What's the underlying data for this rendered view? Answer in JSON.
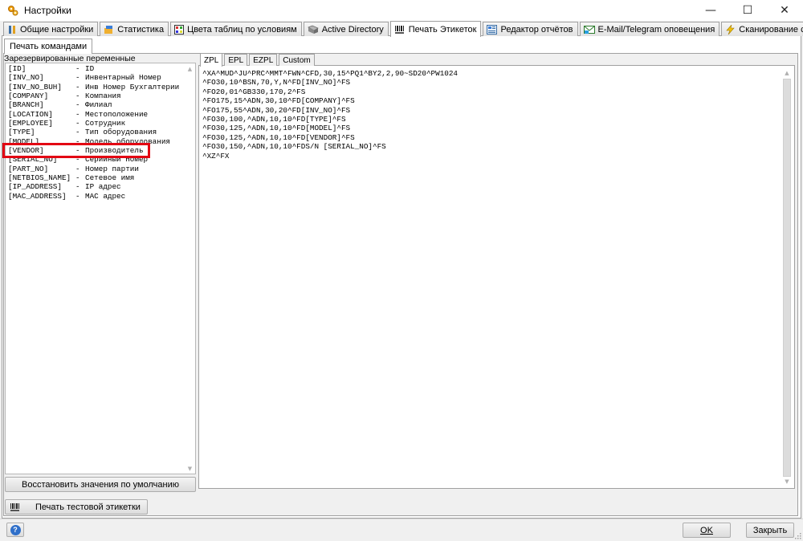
{
  "window": {
    "title": "Настройки",
    "controls": {
      "minimize": "—",
      "maximize": "☐",
      "close": "✕"
    }
  },
  "main_tabs": [
    {
      "label": "Общие настройки",
      "icon": "settings-wrench-icon"
    },
    {
      "label": "Статистика",
      "icon": "statistics-icon"
    },
    {
      "label": "Цвета таблиц по условиям",
      "icon": "color-grid-icon"
    },
    {
      "label": "Active Directory",
      "icon": "directory-icon"
    },
    {
      "label": "Печать Этикеток",
      "icon": "barcode-icon",
      "active": true
    },
    {
      "label": "Редактор отчётов",
      "icon": "report-editor-icon"
    },
    {
      "label": "E-Mail/Telegram оповещения",
      "icon": "email-icon"
    },
    {
      "label": "Сканирование сети",
      "icon": "network-scan-icon"
    }
  ],
  "sub_tab": {
    "label": "Печать командами"
  },
  "variables": {
    "caption": "Зарезервированные переменные",
    "highlighted": "[VENDOR]",
    "items": [
      {
        "name": "[ID]",
        "desc": "ID"
      },
      {
        "name": "[INV_NO]",
        "desc": "Инвентарный Номер"
      },
      {
        "name": "[INV_NO_BUH]",
        "desc": "Инв Номер Бухгалтерии"
      },
      {
        "name": "[COMPANY]",
        "desc": "Компания"
      },
      {
        "name": "[BRANCH]",
        "desc": "Филиал"
      },
      {
        "name": "[LOCATION]",
        "desc": "Местоположение"
      },
      {
        "name": "[EMPLOYEE]",
        "desc": "Сотрудник"
      },
      {
        "name": "[TYPE]",
        "desc": "Тип оборудования"
      },
      {
        "name": "[MODEL]",
        "desc": "Модель оборудования"
      },
      {
        "name": "[VENDOR]",
        "desc": "Производитель"
      },
      {
        "name": "[SERIAL_NO]",
        "desc": "Серийный Номер"
      },
      {
        "name": "[PART_NO]",
        "desc": "Номер партии"
      },
      {
        "name": "[NETBIOS_NAME]",
        "desc": "Сетевое имя"
      },
      {
        "name": "[IP_ADDRESS]",
        "desc": "IP адрес"
      },
      {
        "name": "[MAC_ADDRESS]",
        "desc": "MAC адрес"
      }
    ],
    "separator": "-"
  },
  "buttons": {
    "restore_defaults": "Восстановить значения по умолчанию",
    "print_test": "Печать тестовой этикетки",
    "ok": "OK",
    "close": "Закрыть",
    "help": "?"
  },
  "editor_tabs": [
    "ZPL",
    "EPL",
    "EZPL",
    "Custom"
  ],
  "active_editor_tab": "ZPL",
  "code_lines": [
    "^XA^MUD^JU^PRC^MMT^FWN^CFD,30,15^PQ1^BY2,2,90~SD20^PW1024",
    "^FO30,10^BSN,70,Y,N^FD[INV_NO]^FS",
    "^FO20,01^GB330,170,2^FS",
    "^FO175,15^ADN,30,10^FD[COMPANY]^FS",
    "^FO175,55^ADN,30,20^FD[INV_NO]^FS",
    "^FO30,100,^ADN,10,10^FD[TYPE]^FS",
    "^FO30,125,^ADN,10,10^FD[MODEL]^FS",
    "^FO30,125,^ADN,10,10^FD[VENDOR]^FS",
    "^FO30,150,^ADN,10,10^FDS/N [SERIAL_NO]^FS",
    "^XZ^FX"
  ],
  "colors": {
    "highlight_border": "#e30613",
    "help_icon": "#2f6fc9"
  }
}
